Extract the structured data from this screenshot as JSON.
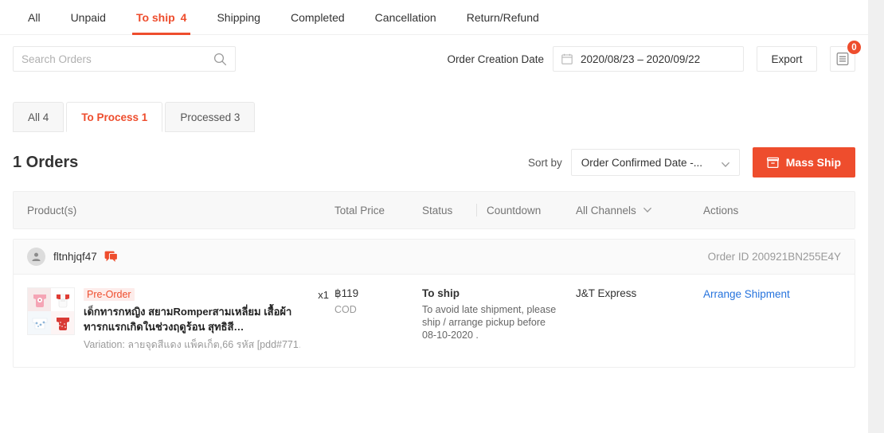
{
  "top_tabs": [
    {
      "label": "All",
      "count": "",
      "active": false
    },
    {
      "label": "Unpaid",
      "count": "",
      "active": false
    },
    {
      "label": "To ship",
      "count": "4",
      "active": true
    },
    {
      "label": "Shipping",
      "count": "",
      "active": false
    },
    {
      "label": "Completed",
      "count": "",
      "active": false
    },
    {
      "label": "Cancellation",
      "count": "",
      "active": false
    },
    {
      "label": "Return/Refund",
      "count": "",
      "active": false
    }
  ],
  "filters": {
    "search_placeholder": "Search Orders",
    "search_value": "",
    "search_icon": "search-icon",
    "date_label": "Order Creation Date",
    "date_value": "2020/08/23 – 2020/09/22",
    "calendar_icon": "calendar-icon",
    "export_label": "Export",
    "menu_icon": "document-list-icon",
    "menu_badge": "0"
  },
  "sub_tabs": [
    {
      "label": "All 4",
      "active": false
    },
    {
      "label": "To Process 1",
      "active": true
    },
    {
      "label": "Processed 3",
      "active": false
    }
  ],
  "orders_header": {
    "count_label": "1 Orders",
    "sort_label": "Sort by",
    "sort_value": "Order Confirmed Date -...",
    "sort_chevron": "chevron-down-icon",
    "mass_ship_label": "Mass Ship",
    "mass_ship_icon": "box-icon"
  },
  "table": {
    "columns": {
      "product": "Product(s)",
      "total_price": "Total Price",
      "status": "Status",
      "countdown": "Countdown",
      "channel": "All Channels",
      "channel_chevron": "chevron-down-icon",
      "actions": "Actions"
    }
  },
  "orders": [
    {
      "buyer": "fltnhjqf47",
      "avatar_icon": "user-avatar-icon",
      "chat_icon": "chat-bubble-icon",
      "order_id": "Order ID 200921BN255E4Y",
      "product": {
        "tag": "Pre-Order",
        "name": "เด็กทารกหญิง สยามRomperสามเหลี่ยม เสื้อผ้าทารกแรกเกิดในช่วงฤดูร้อน สุทธิสี…",
        "variation": "Variation: ลายจุดสีแดง แพ็คเก็ต,66 รหัส [pdd#771…",
        "quantity": "x1"
      },
      "price": "฿119",
      "payment": "COD",
      "status_title": "To ship",
      "status_note": "To avoid late shipment, please ship / arrange pickup before 08-10-2020 .",
      "channel": "J&T Express",
      "action": "Arrange Shipment"
    }
  ],
  "colors": {
    "accent": "#ee4d2d",
    "link": "#2673dd",
    "text": "#333333",
    "muted": "#9a9a9a"
  }
}
